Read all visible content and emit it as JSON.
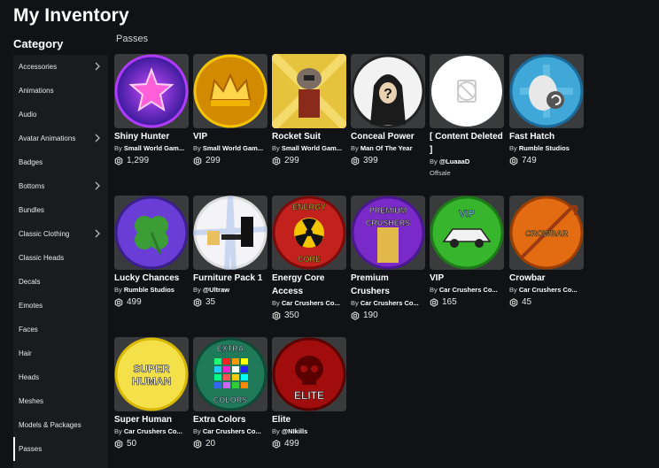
{
  "page_title": "My Inventory",
  "category_heading": "Category",
  "section_heading": "Passes",
  "sidebar": [
    {
      "label": "Accessories",
      "chevron": true
    },
    {
      "label": "Animations",
      "chevron": false
    },
    {
      "label": "Audio",
      "chevron": false
    },
    {
      "label": "Avatar Animations",
      "chevron": true
    },
    {
      "label": "Badges",
      "chevron": false
    },
    {
      "label": "Bottoms",
      "chevron": true
    },
    {
      "label": "Bundles",
      "chevron": false
    },
    {
      "label": "Classic Clothing",
      "chevron": true
    },
    {
      "label": "Classic Heads",
      "chevron": false
    },
    {
      "label": "Decals",
      "chevron": false
    },
    {
      "label": "Emotes",
      "chevron": false
    },
    {
      "label": "Faces",
      "chevron": false
    },
    {
      "label": "Hair",
      "chevron": false
    },
    {
      "label": "Heads",
      "chevron": false
    },
    {
      "label": "Meshes",
      "chevron": false
    },
    {
      "label": "Models & Packages",
      "chevron": false
    },
    {
      "label": "Passes",
      "chevron": false,
      "active": true
    }
  ],
  "items": [
    {
      "name": "Shiny Hunter",
      "creator": "Small World Gam...",
      "price": "1,299",
      "icon": "star-icon"
    },
    {
      "name": "VIP",
      "creator": "Small World Gam...",
      "price": "299",
      "icon": "crown-icon"
    },
    {
      "name": "Rocket Suit",
      "creator": "Small World Gam...",
      "price": "299",
      "icon": "raccoon-icon"
    },
    {
      "name": "Conceal Power",
      "creator": "Man Of The Year",
      "price": "399",
      "icon": "hooded-figure-icon"
    },
    {
      "name": "[ Content Deleted ]",
      "creator": "@LuaaaD",
      "price": null,
      "status": "Offsale",
      "icon": "deleted-content-icon"
    },
    {
      "name": "Fast Hatch",
      "creator": "Rumble Studios",
      "price": "749",
      "icon": "egg-hatch-icon"
    },
    {
      "name": "Lucky Chances",
      "creator": "Rumble Studios",
      "price": "499",
      "icon": "clover-icon"
    },
    {
      "name": "Furniture Pack 1",
      "creator": "@Ultraw",
      "price": "35",
      "icon": "furniture-icon"
    },
    {
      "name": "Energy Core Access",
      "creator": "Car Crushers Co...",
      "price": "350",
      "icon": "radiation-icon",
      "badge_text_top": "ENERGY",
      "badge_text_bottom": "CORE"
    },
    {
      "name": "Premium Crushers",
      "creator": "Car Crushers Co...",
      "price": "190",
      "icon": "premium-crushers-icon",
      "badge_text_top": "PREMIUM",
      "badge_text_bottom": "CRUSHERS"
    },
    {
      "name": "VIP",
      "creator": "Car Crushers Co...",
      "price": "165",
      "icon": "vip-car-icon",
      "badge_text_top": "VIP"
    },
    {
      "name": "Crowbar",
      "creator": "Car Crushers Co...",
      "price": "45",
      "icon": "crowbar-icon",
      "badge_text_top": "CROWBAR"
    },
    {
      "name": "Super Human",
      "creator": "Car Crushers Co...",
      "price": "50",
      "icon": "super-human-icon",
      "badge_text_top": "SUPER",
      "badge_text_bottom": "HUMAN"
    },
    {
      "name": "Extra Colors",
      "creator": "Car Crushers Co...",
      "price": "20",
      "icon": "color-palette-icon",
      "badge_text_top": "EXTRA",
      "badge_text_bottom": "COLORS"
    },
    {
      "name": "Elite",
      "creator": "@NIkills",
      "price": "499",
      "icon": "skull-icon",
      "badge_text_top": "ELITE"
    }
  ],
  "by_prefix": "By",
  "colors": {
    "background": "#111216",
    "sidebar": "#191b1f",
    "card": "#393b3d"
  }
}
